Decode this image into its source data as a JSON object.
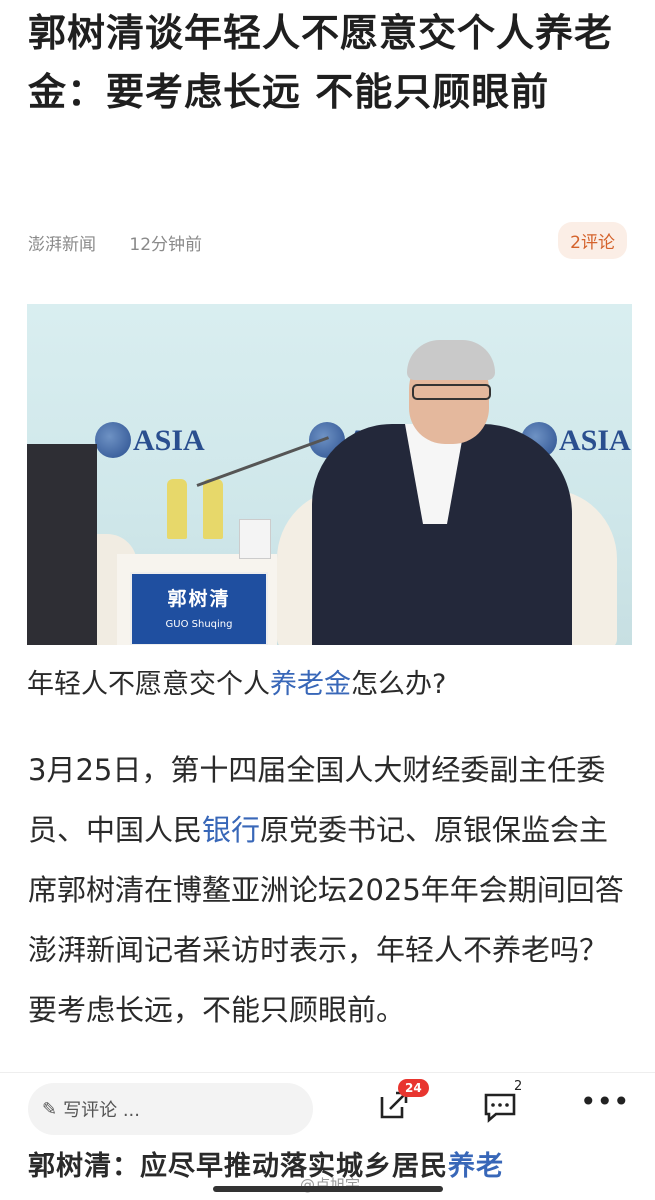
{
  "article": {
    "headline": "郭树清谈年轻人不愿意交个人养老金：要考虑长远 不能只顾眼前",
    "source": "澎湃新闻",
    "time": "12分钟前",
    "comment_badge": "2评论"
  },
  "photo": {
    "logo_text": "ASIA",
    "nameplate_cn": "郭树清",
    "nameplate_en": "GUO Shuqing"
  },
  "caption": {
    "before": "年轻人不愿意交个人",
    "link": "养老金",
    "after": "怎么办?"
  },
  "body": {
    "part1": "3月25日，第十四届全国人大财经委副主任委员、中国人民",
    "link": "银行",
    "part2": "原党委书记、原银保监会主席郭树清在博鳌亚洲论坛2025年年会期间回答澎湃新闻记者采访时表示，年轻人不养老吗？要考虑长远，不能只顾眼前。"
  },
  "bottom_bar": {
    "comment_placeholder": "写评论 ...",
    "share_count": "24",
    "comment_count": "2"
  },
  "next_article": {
    "title_before": "郭树清：应尽早推动落实城乡居民",
    "title_link": "养老"
  },
  "watermark": "@卢旭宇"
}
